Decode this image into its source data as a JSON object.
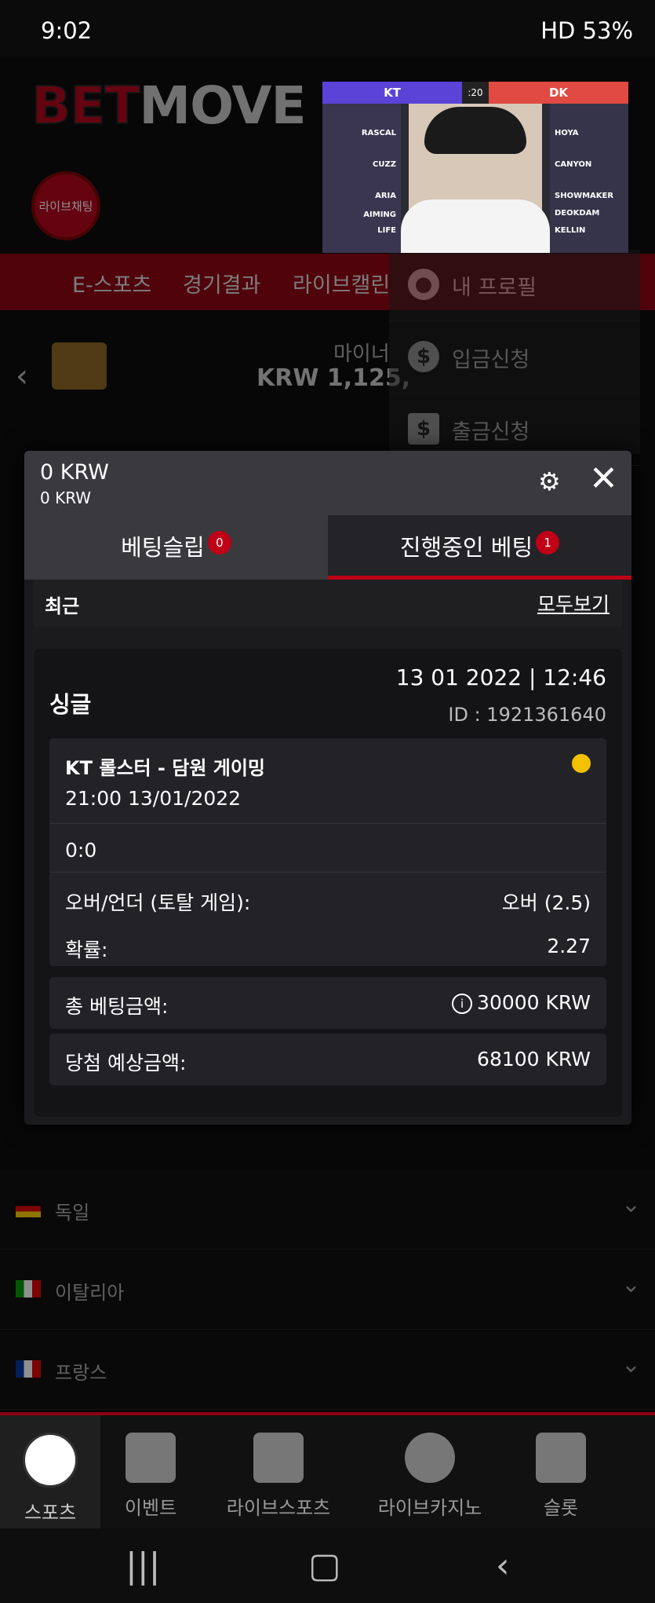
{
  "status_bar": {
    "time": "9:02",
    "right": "HD  53%"
  },
  "brand": {
    "bet": "BET",
    "move": "MOVE"
  },
  "livechat": {
    "label": "라이브채팅"
  },
  "top_nav": {
    "items": [
      "E-스포츠",
      "경기결과",
      "라이브캘린"
    ]
  },
  "account": {
    "label_partial": "마이너",
    "amount_partial": "KRW 1,125,"
  },
  "profile_menu": {
    "items": [
      {
        "label": "내 프로필",
        "icon": "user-icon"
      },
      {
        "label": "입금신청",
        "icon": "dollar-icon"
      },
      {
        "label": "출금신청",
        "icon": "atm-icon"
      }
    ]
  },
  "stream": {
    "team_left": "KT",
    "team_right": "DK",
    "clock": ":20",
    "left_players": [
      "RASCAL",
      "CUZZ",
      "ARIA",
      "AIMING",
      "LIFE"
    ],
    "right_players": [
      "HOYA",
      "CANYON",
      "SHOWMAKER",
      "DEOKDAM",
      "KELLIN"
    ]
  },
  "countries": [
    {
      "name": "독일"
    },
    {
      "name": "이탈리아"
    },
    {
      "name": "프랑스"
    }
  ],
  "bottom_nav": {
    "items": [
      {
        "label": "스포츠",
        "icon": "soccer-ball-icon"
      },
      {
        "label": "이벤트",
        "icon": "gift-icon"
      },
      {
        "label": "라이브스포츠",
        "icon": "live-tv-icon"
      },
      {
        "label": "라이브카지노",
        "icon": "casino-chip-icon"
      },
      {
        "label": "슬롯",
        "icon": "slot-machine-icon"
      }
    ]
  },
  "betslip": {
    "balance_main": "0 KRW",
    "balance_sub": "0 KRW",
    "tab_slip": "베팅슬립",
    "tab_slip_count": "0",
    "tab_open": "진행중인 베팅",
    "tab_open_count": "1",
    "recent_label": "최근",
    "view_all": "모두보기",
    "bet": {
      "type": "싱글",
      "datetime": "13 01 2022 | 12:46",
      "id": "ID :  1921361640",
      "match": "KT 롤스터 - 담원 게이밍",
      "match_time": "21:00   13/01/2022",
      "score": "0:0",
      "market_label": "오버/언더 (토탈 게임):",
      "market_value": "오버 (2.5)",
      "odds_label": "확률:",
      "odds_value": "2.27",
      "stake_label": "총 베팅금액:",
      "stake_value": "30000 KRW",
      "payout_label": "당첨 예상금액:",
      "payout_value": "68100 KRW"
    }
  },
  "colors": {
    "accent": "#c00016",
    "clock": "#f2c200",
    "panel": "#1b1b1e"
  }
}
